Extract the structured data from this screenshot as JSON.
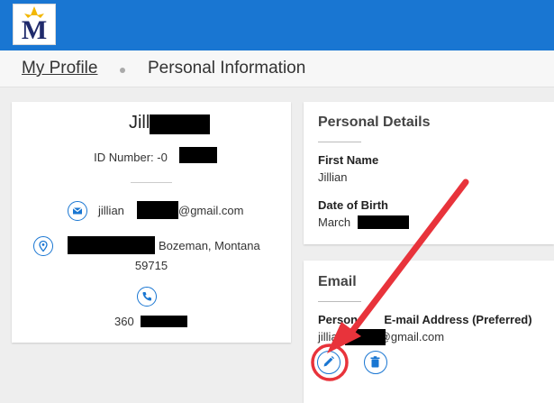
{
  "header": {
    "logo_letter": "M",
    "colors": {
      "bar": "#1976d2",
      "logo_navy": "#1f2a6b",
      "logo_gold": "#f2b705",
      "annotation": "#e8333b"
    }
  },
  "breadcrumb": {
    "link_label": "My Profile",
    "current_label": "Personal Information"
  },
  "profile_card": {
    "name": "Jillian",
    "id_label": "ID Number: -0",
    "email_prefix": "jillian",
    "email_suffix": "@gmail.com",
    "address_city": "Bozeman, Montana",
    "address_zip": "59715",
    "phone_prefix": "360",
    "icons": [
      "email-icon",
      "location-icon",
      "phone-icon"
    ]
  },
  "personal_details": {
    "title": "Personal Details",
    "first_name_label": "First Name",
    "first_name_value": "Jillian",
    "dob_label": "Date of Birth",
    "dob_value": "March"
  },
  "email_section": {
    "title": "Email",
    "address_label_start": "Person",
    "address_label_end": "E-mail Address (Preferred)",
    "email_prefix": "jillia",
    "email_suffix": "@gmail.com",
    "actions": [
      "edit-icon",
      "delete-icon"
    ]
  }
}
